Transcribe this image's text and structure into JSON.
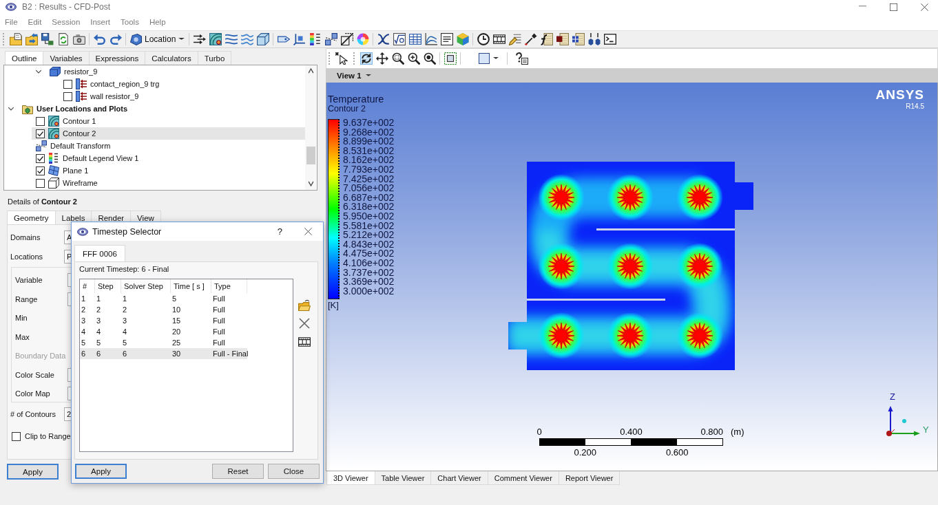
{
  "window": {
    "title": "B2 : Results - CFD-Post"
  },
  "menu": [
    "File",
    "Edit",
    "Session",
    "Insert",
    "Tools",
    "Help"
  ],
  "toolbar": {
    "location_button": "Location"
  },
  "outline_panel": {
    "tabs": [
      {
        "label": "Outline",
        "selected": true
      },
      {
        "label": "Variables",
        "selected": false
      },
      {
        "label": "Expressions",
        "selected": false
      },
      {
        "label": "Calculators",
        "selected": false
      },
      {
        "label": "Turbo",
        "selected": false
      }
    ],
    "tree": [
      {
        "children": [
          {
            "children": [
              {
                "label": "resistor_9",
                "kind": "domain",
                "expanded": true,
                "selected": false,
                "children": [
                  {
                    "label": "contact_region_9 trg",
                    "kind": "boundary",
                    "checked": false,
                    "selected": false
                  },
                  {
                    "label": "wall resistor_9",
                    "kind": "boundary",
                    "checked": false,
                    "selected": false
                  }
                ]
              }
            ]
          }
        ]
      },
      {
        "label": "User Locations and Plots",
        "kind": "folder",
        "expanded": true,
        "selected": false,
        "children": [
          {
            "label": "Contour 1",
            "kind": "contour",
            "checked": false,
            "selected": false
          },
          {
            "label": "Contour 2",
            "kind": "contour",
            "checked": true,
            "selected": true
          },
          {
            "label": "Default Transform",
            "kind": "transform",
            "selected": false
          },
          {
            "label": "Default Legend View 1",
            "kind": "legend",
            "checked": true,
            "selected": false
          },
          {
            "label": "Plane 1",
            "kind": "plane",
            "checked": true,
            "selected": false
          },
          {
            "label": "Wireframe",
            "kind": "wireframe",
            "checked": false,
            "selected": false
          }
        ]
      }
    ]
  },
  "details": {
    "title": "Details of **Contour 2**",
    "tabs": [
      {
        "label": "Geometry",
        "selected": true
      },
      {
        "label": "Labels",
        "selected": false
      },
      {
        "label": "Render",
        "selected": false
      },
      {
        "label": "View",
        "selected": false
      }
    ],
    "rows": [
      {
        "label": "Domains",
        "value": "A"
      },
      {
        "label": "Locations",
        "value": "P"
      }
    ],
    "group": [
      {
        "kind": "field",
        "label": "Variable",
        "disabled": false
      },
      {
        "kind": "field",
        "label": "Range",
        "disabled": false
      },
      {
        "kind": "label",
        "label": "Min",
        "disabled": false
      },
      {
        "kind": "label",
        "label": "Max",
        "disabled": false
      },
      {
        "kind": "label",
        "label": "Boundary Data",
        "disabled": true
      },
      {
        "kind": "field",
        "label": "Color Scale",
        "disabled": false
      },
      {
        "kind": "field",
        "label": "Color Map",
        "disabled": false
      }
    ],
    "contours": {
      "label": "# of Contours",
      "value": "2"
    },
    "clip_to_range": {
      "label": "Clip to Range",
      "checked": false
    },
    "apply_button": {
      "label": "Apply",
      "default": true
    }
  },
  "viewer": {
    "tools": [
      {
        "selected": false
      },
      {
        "selected": true
      },
      {
        "selected": false
      },
      {
        "selected": false
      },
      {
        "selected": false
      },
      {
        "selected": false
      }
    ],
    "view_menu": "View 1",
    "legend": {
      "title": "Temperature",
      "subtitle": "Contour 2",
      "values": [
        "9.637e+002",
        "9.268e+002",
        "8.899e+002",
        "8.531e+002",
        "8.162e+002",
        "7.793e+002",
        "7.425e+002",
        "7.056e+002",
        "6.687e+002",
        "6.318e+002",
        "5.950e+002",
        "5.581e+002",
        "5.212e+002",
        "4.843e+002",
        "4.475e+002",
        "4.106e+002",
        "3.737e+002",
        "3.369e+002",
        "3.000e+002"
      ],
      "unit": "[K]"
    },
    "logo": {
      "name": "ANSYS",
      "version": "R14.5"
    },
    "scale_bar": {
      "top_labels": [
        "0",
        "0.400",
        "0.800"
      ],
      "unit": "(m)",
      "bottom_labels": [
        "0.200",
        "0.600"
      ]
    },
    "axes": {
      "vertical": "Z",
      "horizontal": "Y"
    },
    "tabs": [
      {
        "label": "3D Viewer",
        "selected": true
      },
      {
        "label": "Table Viewer",
        "selected": false
      },
      {
        "label": "Chart Viewer",
        "selected": false
      },
      {
        "label": "Comment Viewer",
        "selected": false
      },
      {
        "label": "Report Viewer",
        "selected": false
      }
    ]
  },
  "timestep_dialog": {
    "title": "Timestep Selector",
    "help": "?",
    "tabs": [
      {
        "label": "FFF 0006",
        "selected": true
      }
    ],
    "current_timestep": "Current Timestep: 6 - Final",
    "table": {
      "columns": [
        "#",
        "Step",
        "Solver Step",
        "Time [ s ]",
        "Type"
      ],
      "rows": [
        {
          "cells": [
            "1",
            "1",
            "1",
            "5",
            "Full"
          ],
          "selected": false
        },
        {
          "cells": [
            "2",
            "2",
            "2",
            "10",
            "Full"
          ],
          "selected": false
        },
        {
          "cells": [
            "3",
            "3",
            "3",
            "15",
            "Full"
          ],
          "selected": false
        },
        {
          "cells": [
            "4",
            "4",
            "4",
            "20",
            "Full"
          ],
          "selected": false
        },
        {
          "cells": [
            "5",
            "5",
            "5",
            "25",
            "Full"
          ],
          "selected": false
        },
        {
          "cells": [
            "6",
            "6",
            "6",
            "30",
            "Full - Final"
          ],
          "selected": true
        }
      ]
    },
    "buttons": [
      {
        "label": "Apply",
        "default": true
      },
      {
        "label": "Reset",
        "default": false
      },
      {
        "label": "Close",
        "default": false
      }
    ]
  }
}
